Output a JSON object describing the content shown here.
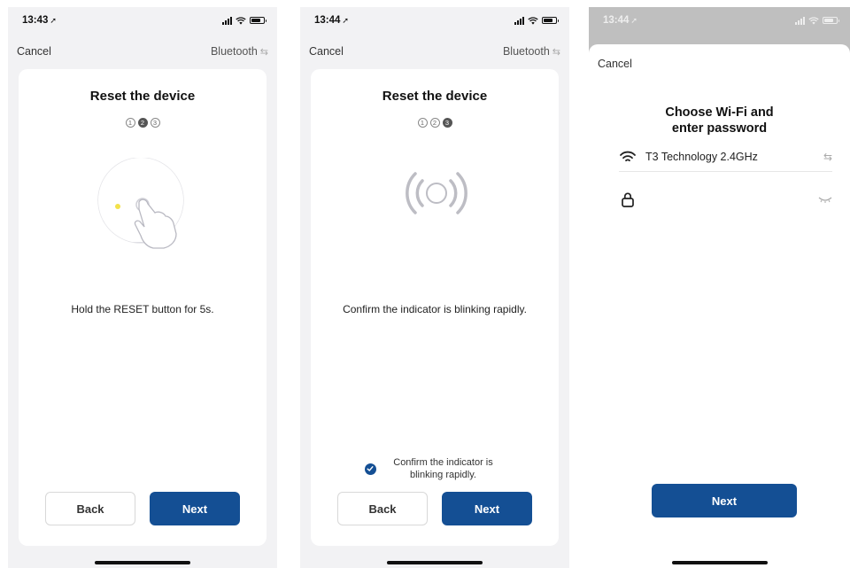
{
  "screens": [
    {
      "status": {
        "time": "13:43",
        "loc": "➚"
      },
      "topbar": {
        "cancel": "Cancel",
        "bluetooth": "Bluetooth",
        "swap": "⇆"
      },
      "title": "Reset the device",
      "steps": [
        "1",
        "2",
        "3"
      ],
      "active_step": 2,
      "instruction": "Hold the RESET button for 5s.",
      "buttons": {
        "back": "Back",
        "next": "Next"
      }
    },
    {
      "status": {
        "time": "13:44",
        "loc": "➚"
      },
      "topbar": {
        "cancel": "Cancel",
        "bluetooth": "Bluetooth",
        "swap": "⇆"
      },
      "title": "Reset the device",
      "steps": [
        "1",
        "2",
        "3"
      ],
      "active_step": 3,
      "instruction": "Confirm the indicator is blinking rapidly.",
      "confirm_checkbox": {
        "label": "Confirm the indicator is blinking rapidly.",
        "checked": true
      },
      "buttons": {
        "back": "Back",
        "next": "Next"
      }
    },
    {
      "status": {
        "time": "13:44",
        "loc": "➚"
      },
      "cancel": "Cancel",
      "title_line1": "Choose Wi-Fi and",
      "title_line2": "enter password",
      "ssid": "T3 Technology 2.4GHz",
      "password_value": "",
      "buttons": {
        "next": "Next"
      }
    }
  ],
  "colors": {
    "primary": "#144f94",
    "background": "#f2f2f4",
    "card": "#ffffff"
  }
}
